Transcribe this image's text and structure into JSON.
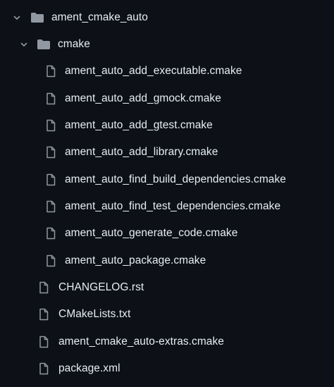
{
  "tree": {
    "root": {
      "name": "ament_cmake_auto",
      "expanded": true,
      "icon": "folder-icon",
      "children_folder": {
        "name": "cmake",
        "expanded": true,
        "icon": "folder-icon",
        "files": [
          "ament_auto_add_executable.cmake",
          "ament_auto_add_gmock.cmake",
          "ament_auto_add_gtest.cmake",
          "ament_auto_add_library.cmake",
          "ament_auto_find_build_dependencies.cmake",
          "ament_auto_find_test_dependencies.cmake",
          "ament_auto_generate_code.cmake",
          "ament_auto_package.cmake"
        ]
      },
      "files": [
        "CHANGELOG.rst",
        "CMakeLists.txt",
        "ament_cmake_auto-extras.cmake",
        "package.xml"
      ]
    }
  },
  "colors": {
    "background": "#0d1117",
    "text": "#e6edf3",
    "icon": "#9198a1"
  }
}
